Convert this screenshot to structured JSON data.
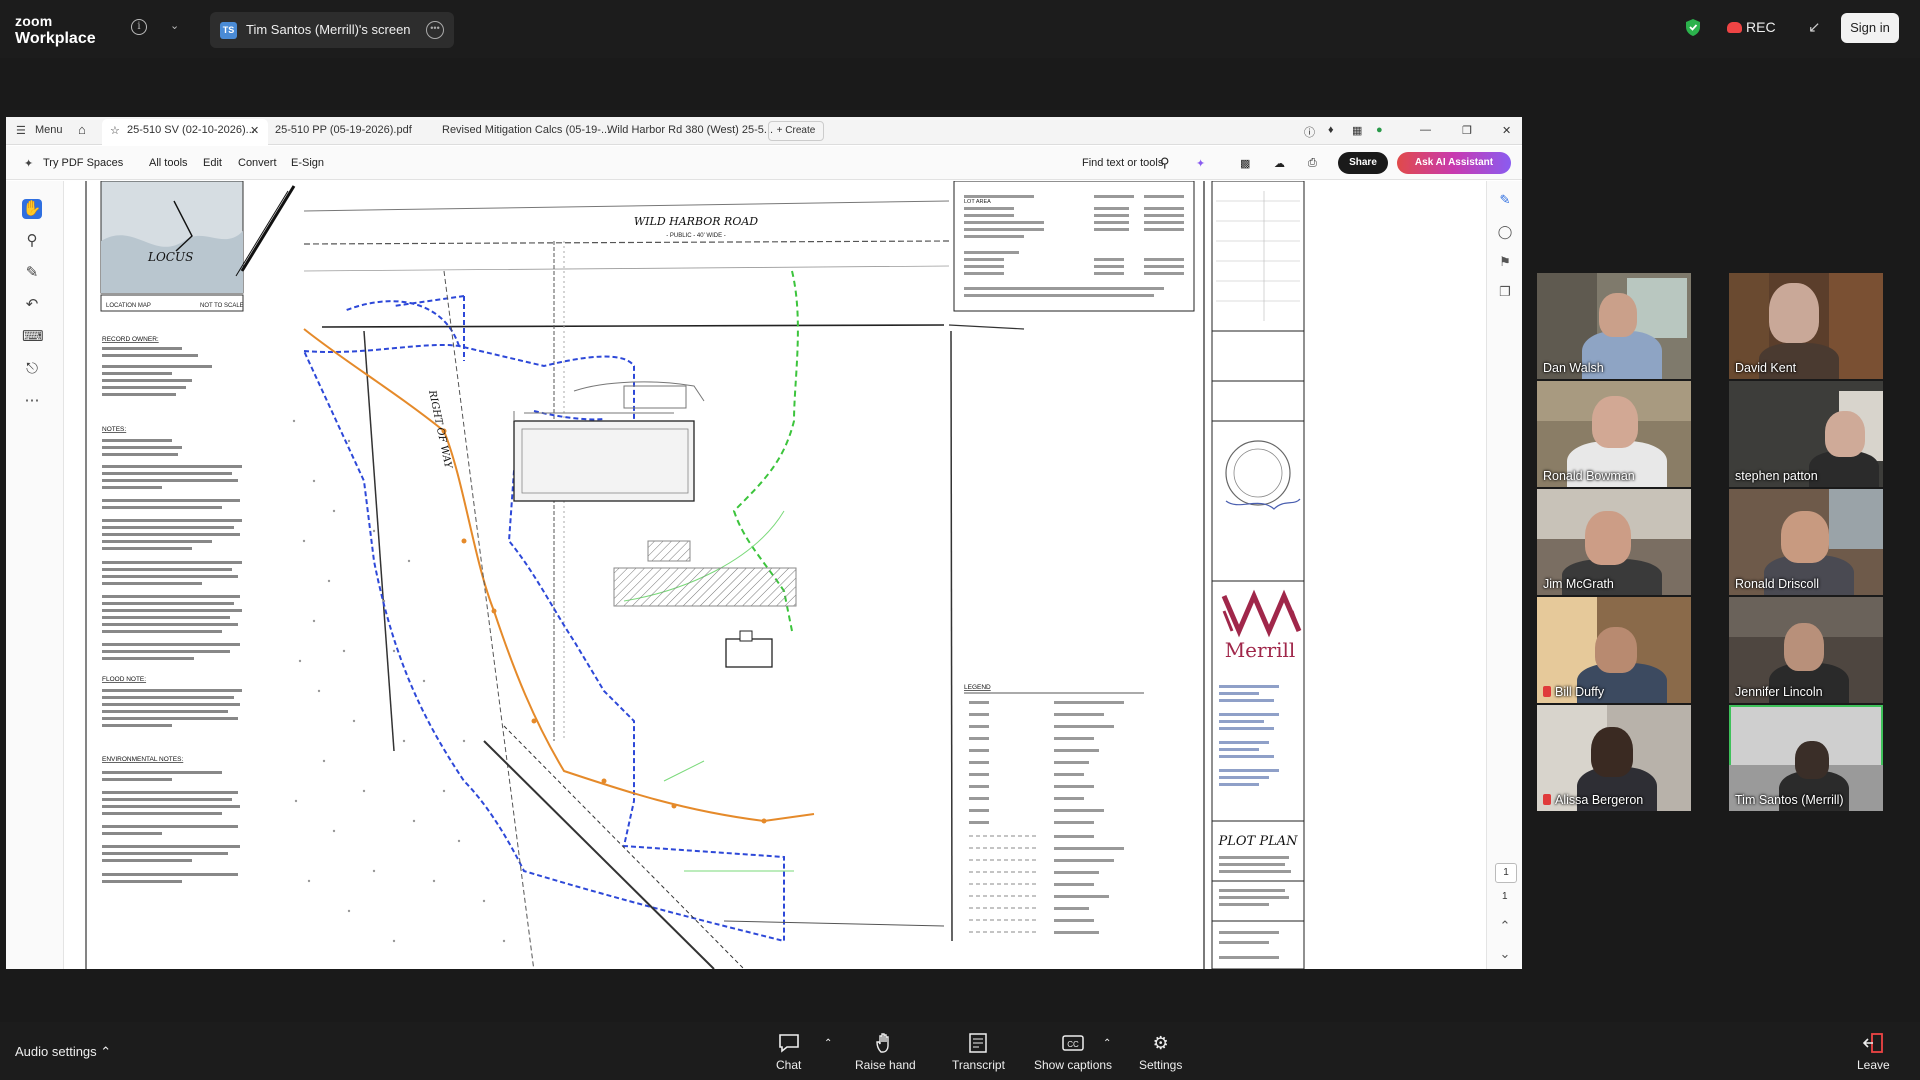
{
  "zoom": {
    "brand_line1": "zoom",
    "brand_line2": "Workplace",
    "share_tab_initials": "TS",
    "share_tab_label": "Tim Santos (Merrill)'s screen",
    "rec_label": "REC",
    "signin_label": "Sign in"
  },
  "pdf": {
    "menu_label": "Menu",
    "tabs": [
      "25-510 SV (02-10-2026)...",
      "25-510 PP (05-19-2026).pdf",
      "Revised Mitigation Calcs (05-19-...",
      "Wild Harbor Rd 380 (West) 25-5..."
    ],
    "create_label": "Create",
    "toolbar": {
      "spaces": "Try PDF Spaces",
      "all_tools": "All tools",
      "edit": "Edit",
      "convert": "Convert",
      "esign": "E-Sign",
      "find": "Find text or tools",
      "share": "Share",
      "ai": "Ask AI Assistant"
    },
    "page_current": "1",
    "page_total": "1"
  },
  "plan": {
    "road": "WILD HARBOR ROAD",
    "road_sub": "- PUBLIC - 40' WIDE -",
    "locus": "LOCUS",
    "location_map": "LOCATION MAP",
    "not_to_scale": "NOT TO SCALE",
    "right_of_way": "RIGHT OF WAY",
    "record_owner": "RECORD OWNER:",
    "notes": "NOTES:",
    "flood_note": "FLOOD NOTE:",
    "env_notes": "ENVIRONMENTAL NOTES:",
    "legend": "LEGEND",
    "merrill": "Merrill",
    "plot_plan": "PLOT PLAN",
    "lot_area": "LOT AREA"
  },
  "participants": [
    {
      "name": "Dan Walsh",
      "muted": false
    },
    {
      "name": "David Kent",
      "muted": false
    },
    {
      "name": "Ronald Bowman",
      "muted": false
    },
    {
      "name": "stephen patton",
      "muted": false
    },
    {
      "name": "Jim McGrath",
      "muted": false
    },
    {
      "name": "Ronald Driscoll",
      "muted": false
    },
    {
      "name": "Bill Duffy",
      "muted": true
    },
    {
      "name": "Jennifer Lincoln",
      "muted": false
    },
    {
      "name": "Alissa Bergeron",
      "muted": true
    },
    {
      "name": "Tim Santos (Merrill)",
      "muted": false
    }
  ],
  "controls": {
    "audio_settings": "Audio settings",
    "chat": "Chat",
    "raise_hand": "Raise hand",
    "transcript": "Transcript",
    "show_captions": "Show captions",
    "settings": "Settings",
    "leave": "Leave"
  },
  "colors": {
    "zoom_bg": "#1c1c1c",
    "active_speaker": "#3ec15a",
    "rec_red": "#e44444",
    "parcel_blue": "#2d48d8",
    "wetland_green": "#3cc43c",
    "buffer_orange": "#e58a2a"
  }
}
